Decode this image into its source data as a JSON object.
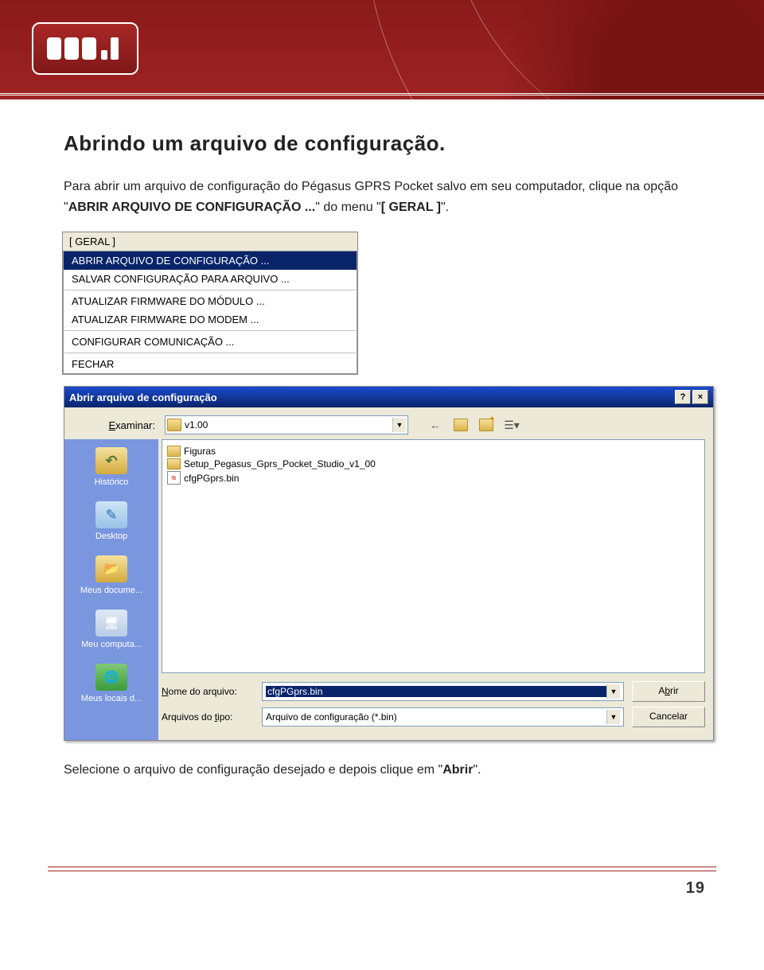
{
  "heading": "Abrindo um arquivo de configuração.",
  "intro_prefix": "Para abrir um arquivo de configuração do Pégasus GPRS Pocket salvo em seu computador, clique na opção \"",
  "intro_bold1": "ABRIR ARQUIVO DE CONFIGURAÇÃO ...",
  "intro_mid": "\" do menu \"",
  "intro_bold2": "[ GERAL ]",
  "intro_suffix": "\".",
  "menu": {
    "title": "[ GERAL ]",
    "items": [
      "ABRIR ARQUIVO DE CONFIGURAÇÃO ...",
      "SALVAR CONFIGURAÇÃO PARA ARQUIVO ...",
      "ATUALIZAR FIRMWARE DO MÓDULO ...",
      "ATUALIZAR FIRMWARE DO MODEM ...",
      "CONFIGURAR COMUNICAÇÃO ...",
      "FECHAR"
    ]
  },
  "dialog": {
    "title": "Abrir arquivo de configuração",
    "help_btn": "?",
    "close_btn": "×",
    "examinar_label": "Examinar:",
    "examinar_value": "v1.00",
    "places": {
      "history": "Histórico",
      "desktop": "Desktop",
      "docs": "Meus docume...",
      "computer": "Meu computa...",
      "network": "Meus locais d..."
    },
    "files": [
      {
        "type": "folder",
        "name": "Figuras"
      },
      {
        "type": "folder",
        "name": "Setup_Pegasus_Gprs_Pocket_Studio_v1_00"
      },
      {
        "type": "bin",
        "name": "cfgPGprs.bin"
      }
    ],
    "filename_label": "Nome do arquivo:",
    "filename_value": "cfgPGprs.bin",
    "filetype_label": "Arquivos do tipo:",
    "filetype_value": "Arquivo de configuração (*.bin)",
    "open_btn_pre": "A",
    "open_btn_u": "b",
    "open_btn_post": "rir",
    "cancel_btn": "Cancelar"
  },
  "closing_prefix": "Selecione o arquivo de configuração desejado e depois clique em \"",
  "closing_bold": "Abrir",
  "closing_suffix": "\".",
  "page_number": "19"
}
